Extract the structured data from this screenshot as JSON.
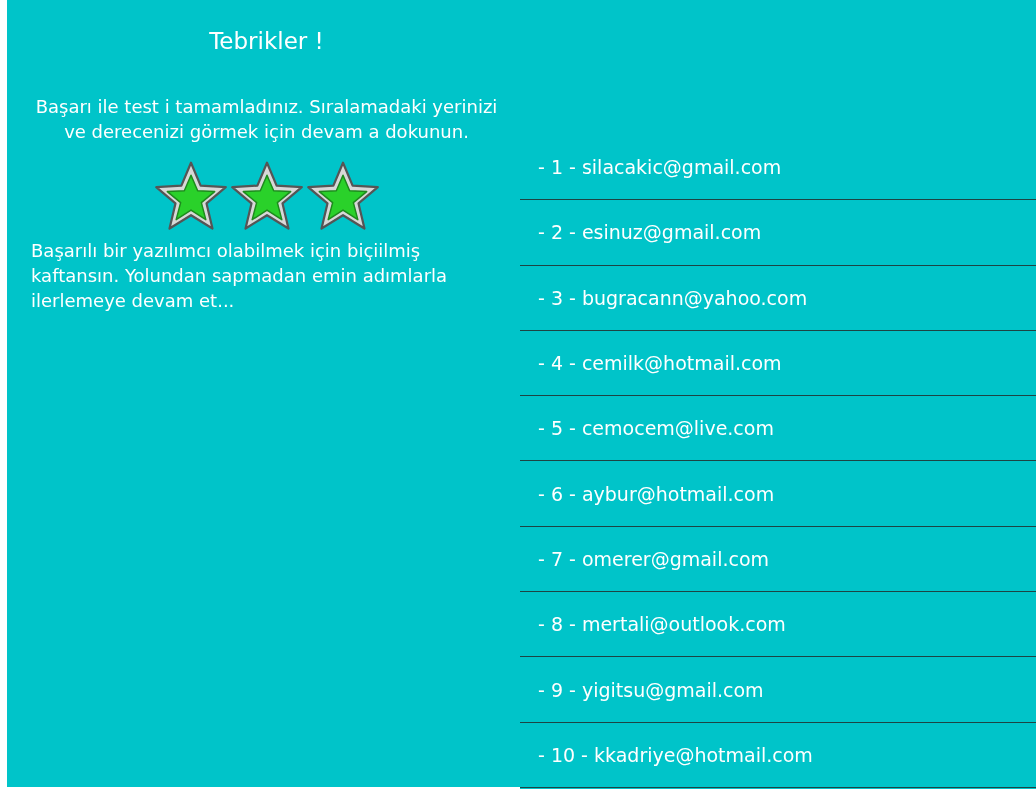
{
  "result": {
    "title": "Tebrikler !",
    "message": "Başarı ile test i tamamladınız. Sıralamadaki yerinizi ve derecenizi görmek için devam a dokunun.",
    "stars": 3,
    "comment": "Başarılı bir yazılımcı olabilmek için biçiilmiş kaftansın. Yolundan sapmadan emin adımlarla ilerlemeye devam et..."
  },
  "ranking": [
    {
      "label": "- 1 - silacakic@gmail.com"
    },
    {
      "label": "- 2 - esinuz@gmail.com"
    },
    {
      "label": "- 3 - bugracann@yahoo.com"
    },
    {
      "label": "- 4 - cemilk@hotmail.com"
    },
    {
      "label": "- 5 - cemocem@live.com"
    },
    {
      "label": "- 6 - aybur@hotmail.com"
    },
    {
      "label": "- 7 - omerer@gmail.com"
    },
    {
      "label": "- 8 - mertali@outlook.com"
    },
    {
      "label": "- 9 - yigitsu@gmail.com"
    },
    {
      "label": "- 10 - kkadriye@hotmail.com"
    }
  ]
}
